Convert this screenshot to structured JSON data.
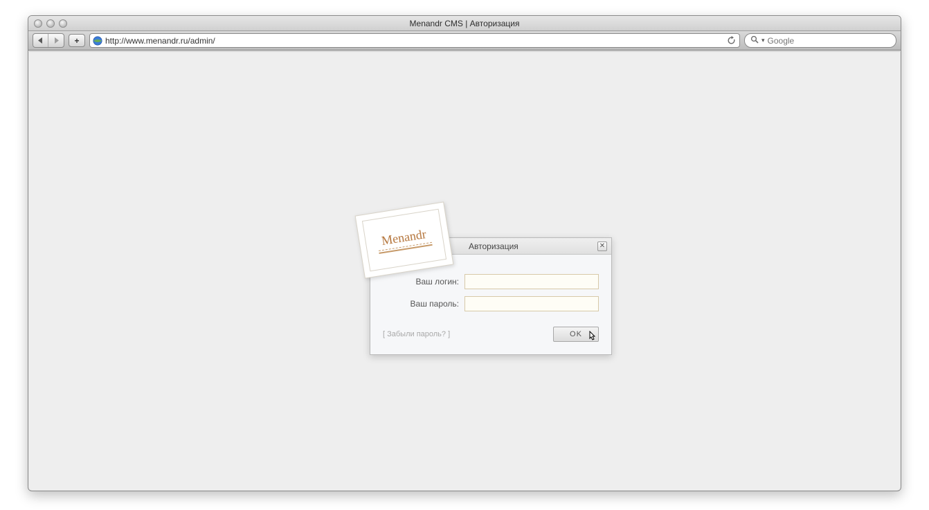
{
  "browser": {
    "title": "Menandr CMS | Авторизация",
    "url": "http://www.menandr.ru/admin/",
    "search_placeholder": "Google"
  },
  "dialog": {
    "title": "Авторизация",
    "login_label": "Ваш логин:",
    "password_label": "Ваш пароль:",
    "login_value": "",
    "password_value": "",
    "forgot_text": "[ Забыли пароль? ]",
    "ok_label": "OK"
  },
  "logo": {
    "brand": "Menandr"
  }
}
